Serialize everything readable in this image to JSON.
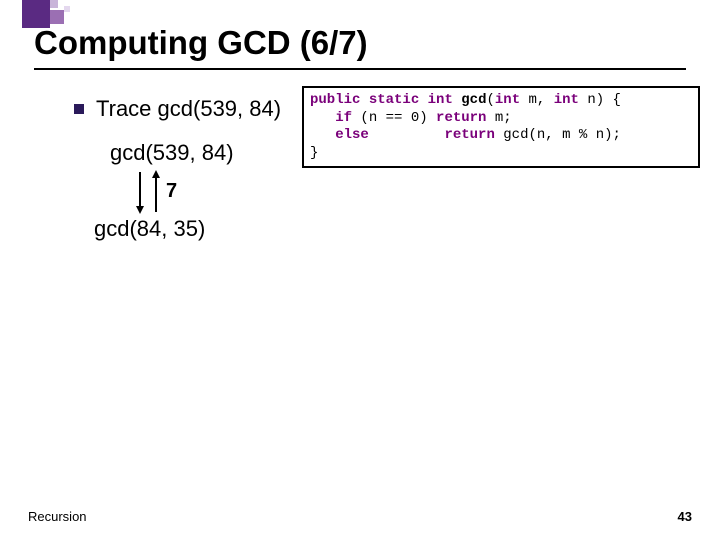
{
  "title": "Computing GCD (6/7)",
  "bullet": "Trace gcd(539, 84)",
  "trace": {
    "call1": "gcd(539, 84)",
    "return1": "7",
    "call2": "gcd(84, 35)"
  },
  "code": {
    "kw_public": "public",
    "kw_static": "static",
    "typ_int1": "int",
    "fn_name": "gcd",
    "typ_int2": "int",
    "param_m": " m, ",
    "typ_int3": "int",
    "param_n": " n) {",
    "line2a": "   ",
    "kw_if": "if",
    "line2b": " (n == 0) ",
    "kw_return1": "return",
    "line2c": " m;",
    "line3a": "   ",
    "kw_else": "else",
    "line3b": "         ",
    "kw_return2": "return",
    "line3c": " gcd(n, m % n);",
    "line4": "}"
  },
  "footer": {
    "left": "Recursion",
    "right": "43"
  }
}
